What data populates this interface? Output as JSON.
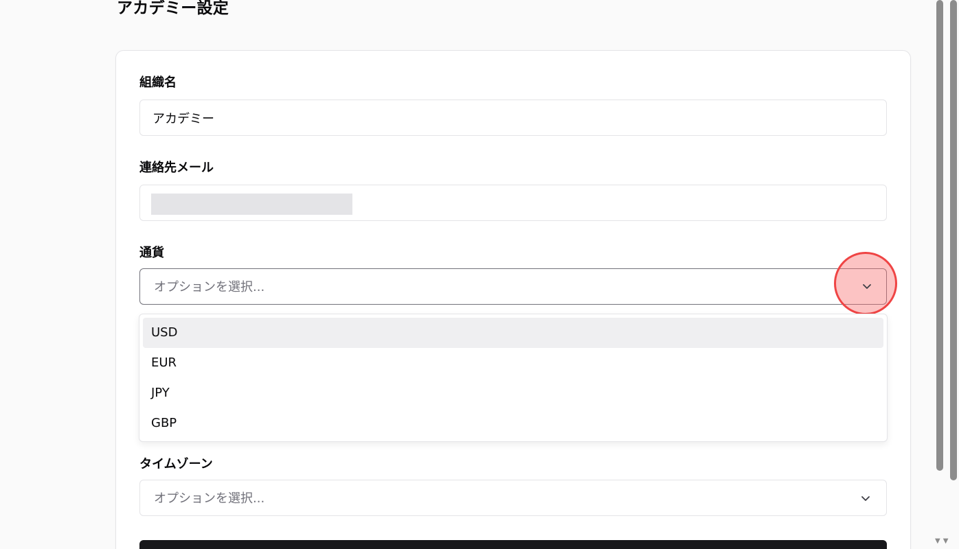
{
  "page": {
    "title": "アカデミー設定"
  },
  "form": {
    "org_name": {
      "label": "組織名",
      "value": "アカデミー"
    },
    "contact_email": {
      "label": "連絡先メール"
    },
    "currency": {
      "label": "通貨",
      "placeholder": "オプションを選択...",
      "options": [
        "USD",
        "EUR",
        "JPY",
        "GBP"
      ],
      "highlighted": "USD"
    },
    "timezone": {
      "label": "タイムゾーン",
      "placeholder": "オプションを選択..."
    }
  },
  "icons": {
    "chevron": "chevron-down-icon",
    "scroll_arrows": "▼▼"
  },
  "colors": {
    "marker_fill": "#f87171",
    "marker_border": "#ef4444",
    "submit": "#18181b",
    "highlight": "#efeff1"
  }
}
